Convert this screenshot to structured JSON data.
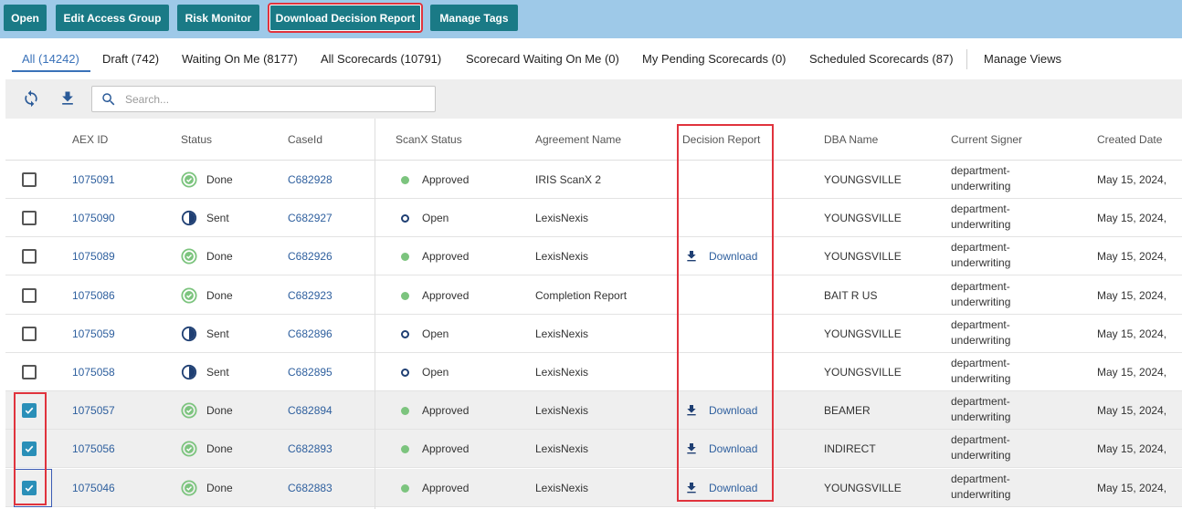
{
  "actions": {
    "open": "Open",
    "edit_access_group": "Edit Access Group",
    "risk_monitor": "Risk Monitor",
    "download_decision_report": "Download Decision Report",
    "manage_tags": "Manage Tags"
  },
  "tabs": [
    {
      "label": "All (14242)",
      "active": true
    },
    {
      "label": "Draft (742)"
    },
    {
      "label": "Waiting On Me (8177)"
    },
    {
      "label": "All Scorecards (10791)"
    },
    {
      "label": "Scorecard Waiting On Me (0)"
    },
    {
      "label": "My Pending Scorecards (0)"
    },
    {
      "label": "Scheduled Scorecards (87)"
    },
    {
      "label": "Manage Views"
    }
  ],
  "toolbar": {
    "search_placeholder": "Search...",
    "refresh_icon": "refresh-icon",
    "download_icon": "download-icon",
    "search_icon": "search-icon"
  },
  "columns": {
    "aex_id": "AEX ID",
    "status": "Status",
    "case_id": "CaseId",
    "scanx_status": "ScanX Status",
    "agreement_name": "Agreement Name",
    "decision_report": "Decision Report",
    "dba_name": "DBA Name",
    "current_signer": "Current Signer",
    "created_date": "Created Date"
  },
  "colors": {
    "action_bar": "#9ec9e8",
    "action_button": "#1a7a86",
    "accent": "#3a72b9",
    "highlight": "#e0333d",
    "done_green": "#7cc47e",
    "checkbox_checked": "#2a8fb8"
  },
  "rows": [
    {
      "checked": false,
      "aex_id": "1075091",
      "status": "Done",
      "case_id": "C682928",
      "scanx": "Approved",
      "agreement": "IRIS ScanX 2",
      "decision": "",
      "dba": "YOUNGSVILLE",
      "signer1": "department-",
      "signer2": "underwriting",
      "created": "May 15, 2024,"
    },
    {
      "checked": false,
      "aex_id": "1075090",
      "status": "Sent",
      "case_id": "C682927",
      "scanx": "Open",
      "agreement": "LexisNexis",
      "decision": "",
      "dba": "YOUNGSVILLE",
      "signer1": "department-",
      "signer2": "underwriting",
      "created": "May 15, 2024,"
    },
    {
      "checked": false,
      "aex_id": "1075089",
      "status": "Done",
      "case_id": "C682926",
      "scanx": "Approved",
      "agreement": "LexisNexis",
      "decision": "Download",
      "dba": "YOUNGSVILLE",
      "signer1": "department-",
      "signer2": "underwriting",
      "created": "May 15, 2024,"
    },
    {
      "checked": false,
      "aex_id": "1075086",
      "status": "Done",
      "case_id": "C682923",
      "scanx": "Approved",
      "agreement": "Completion Report",
      "decision": "",
      "dba": "BAIT R US",
      "signer1": "department-",
      "signer2": "underwriting",
      "created": "May 15, 2024,"
    },
    {
      "checked": false,
      "aex_id": "1075059",
      "status": "Sent",
      "case_id": "C682896",
      "scanx": "Open",
      "agreement": "LexisNexis",
      "decision": "",
      "dba": "YOUNGSVILLE",
      "signer1": "department-",
      "signer2": "underwriting",
      "created": "May 15, 2024,"
    },
    {
      "checked": false,
      "aex_id": "1075058",
      "status": "Sent",
      "case_id": "C682895",
      "scanx": "Open",
      "agreement": "LexisNexis",
      "decision": "",
      "dba": "YOUNGSVILLE",
      "signer1": "department-",
      "signer2": "underwriting",
      "created": "May 15, 2024,"
    },
    {
      "checked": true,
      "aex_id": "1075057",
      "status": "Done",
      "case_id": "C682894",
      "scanx": "Approved",
      "agreement": "LexisNexis",
      "decision": "Download",
      "dba": "BEAMER",
      "signer1": "department-",
      "signer2": "underwriting",
      "created": "May 15, 2024,"
    },
    {
      "checked": true,
      "aex_id": "1075056",
      "status": "Done",
      "case_id": "C682893",
      "scanx": "Approved",
      "agreement": "LexisNexis",
      "decision": "Download",
      "dba": "INDIRECT",
      "signer1": "department-",
      "signer2": "underwriting",
      "created": "May 15, 2024,"
    },
    {
      "checked": true,
      "focused": true,
      "aex_id": "1075046",
      "status": "Done",
      "case_id": "C682883",
      "scanx": "Approved",
      "agreement": "LexisNexis",
      "decision": "Download",
      "dba": "YOUNGSVILLE",
      "signer1": "department-",
      "signer2": "underwriting",
      "created": "May 15, 2024,"
    }
  ]
}
